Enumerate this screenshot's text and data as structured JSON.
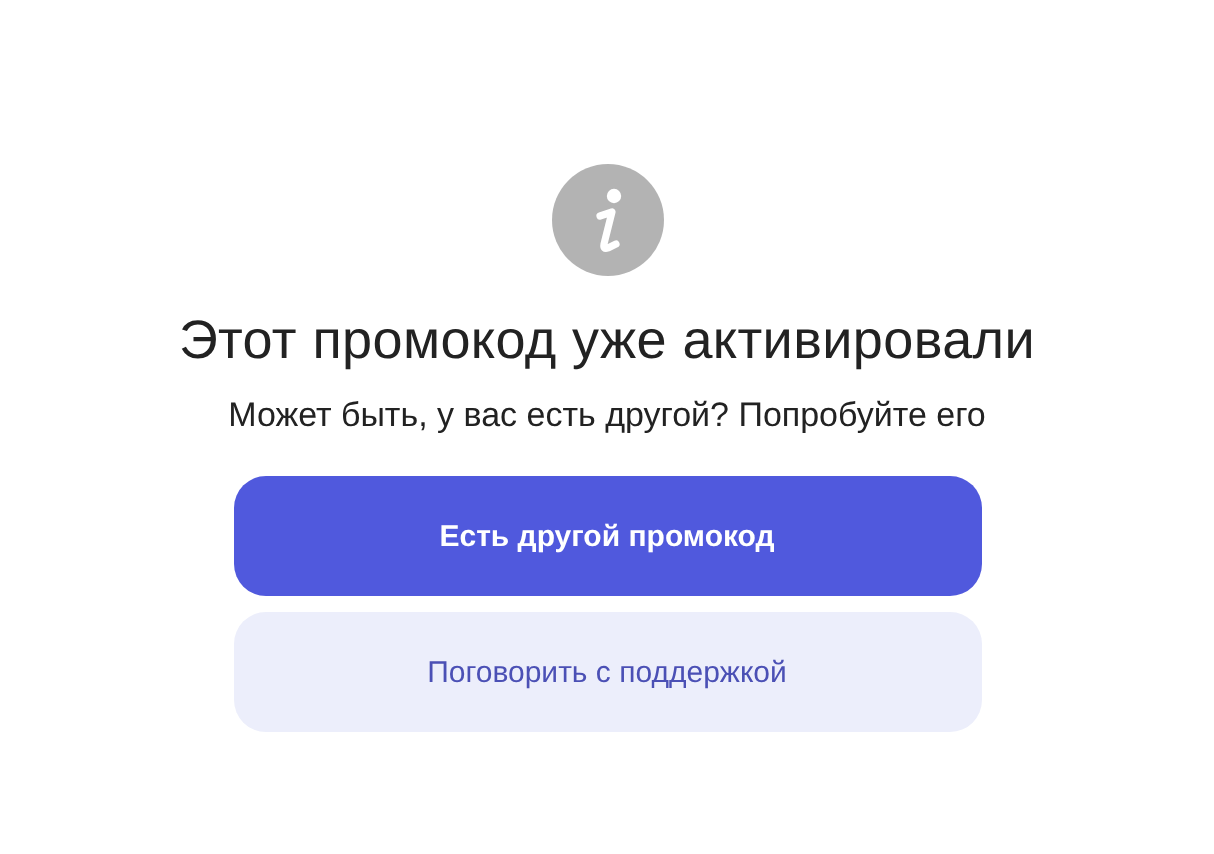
{
  "title": "Этот промокод уже активировали",
  "subtitle": "Может быть, у вас есть другой? Попробуйте его",
  "buttons": [
    {
      "label": "Есть другой промокод",
      "kind": "primary"
    },
    {
      "label": "Поговорить с поддержкой",
      "kind": "secondary"
    }
  ]
}
